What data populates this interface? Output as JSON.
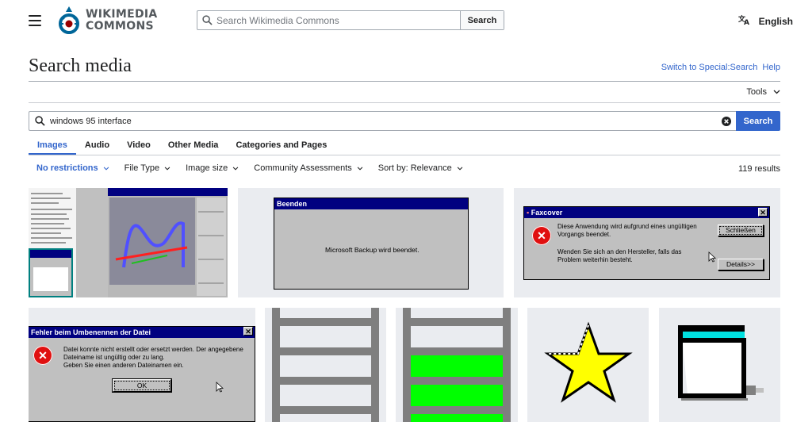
{
  "header": {
    "logo_line1": "WIKIMEDIA",
    "logo_line2": "COMMONS",
    "search_placeholder": "Search Wikimedia Commons",
    "search_button": "Search",
    "language": "English"
  },
  "page": {
    "title": "Search media",
    "link_special_search": "Switch to Special:Search",
    "link_help": "Help",
    "tools": "Tools"
  },
  "search": {
    "query": "windows 95 interface",
    "button": "Search"
  },
  "tabs": [
    {
      "label": "Images",
      "active": true
    },
    {
      "label": "Audio"
    },
    {
      "label": "Video"
    },
    {
      "label": "Other Media"
    },
    {
      "label": "Categories and Pages"
    }
  ],
  "filters": [
    {
      "label": "No restrictions",
      "active": true
    },
    {
      "label": "File Type"
    },
    {
      "label": "Image size"
    },
    {
      "label": "Community Assessments"
    },
    {
      "label": "Sort by: Relevance"
    }
  ],
  "results_count": "119 results",
  "thumbs": {
    "beenden": {
      "title": "Beenden",
      "message": "Microsoft Backup wird beendet."
    },
    "faxcover": {
      "title": "Faxcover",
      "line1": "Diese Anwendung wird aufgrund eines ungültigen",
      "line2": "Vorgangs beendet.",
      "line3": "Wenden Sie sich an den Hersteller, falls das",
      "line4": "Problem weiterhin besteht.",
      "button_close": "Schließen",
      "button_details": "Details>>"
    },
    "rename_error": {
      "title": "Fehler beim Umbenennen der Datei",
      "line1": "Datei konnte nicht erstellt oder ersetzt werden. Der angegebene",
      "line2": "Dateiname ist ungültig oder zu lang.",
      "line3": "Geben Sie einen anderen Dateinamen ein.",
      "button_ok": "OK"
    }
  },
  "colors": {
    "accent": "#3366cc",
    "win95_title": "#000080",
    "win95_face": "#c0c0c0",
    "thumb_bg": "#eaecf0"
  }
}
